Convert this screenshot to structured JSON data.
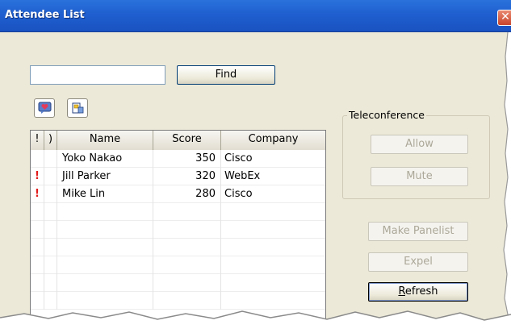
{
  "window": {
    "title": "Attendee List",
    "close_glyph": "✕"
  },
  "search": {
    "value": "",
    "placeholder": "",
    "find_label": "Find"
  },
  "toolbar": {
    "icons": [
      "chat-heart-icon",
      "presenter-icon"
    ]
  },
  "table": {
    "columns": [
      "!",
      ")",
      "Name",
      "Score",
      "Company"
    ],
    "rows": [
      {
        "flag": "",
        "status": "",
        "name": "Yoko Nakao",
        "score": "350",
        "company": "Cisco"
      },
      {
        "flag": "!",
        "status": "",
        "name": "Jill Parker",
        "score": "320",
        "company": "WebEx"
      },
      {
        "flag": "!",
        "status": "",
        "name": "Mike Lin",
        "score": "280",
        "company": "Cisco"
      }
    ]
  },
  "teleconference": {
    "legend": "Teleconference",
    "allow_label": "Allow",
    "mute_label": "Mute"
  },
  "actions": {
    "make_panelist_label": "Make Panelist",
    "expel_label": "Expel",
    "refresh_first": "R",
    "refresh_rest": "efresh"
  },
  "colors": {
    "titlebar": "#1f5fcf",
    "flag": "#e31b1b",
    "dialog_bg": "#ece9d8"
  }
}
